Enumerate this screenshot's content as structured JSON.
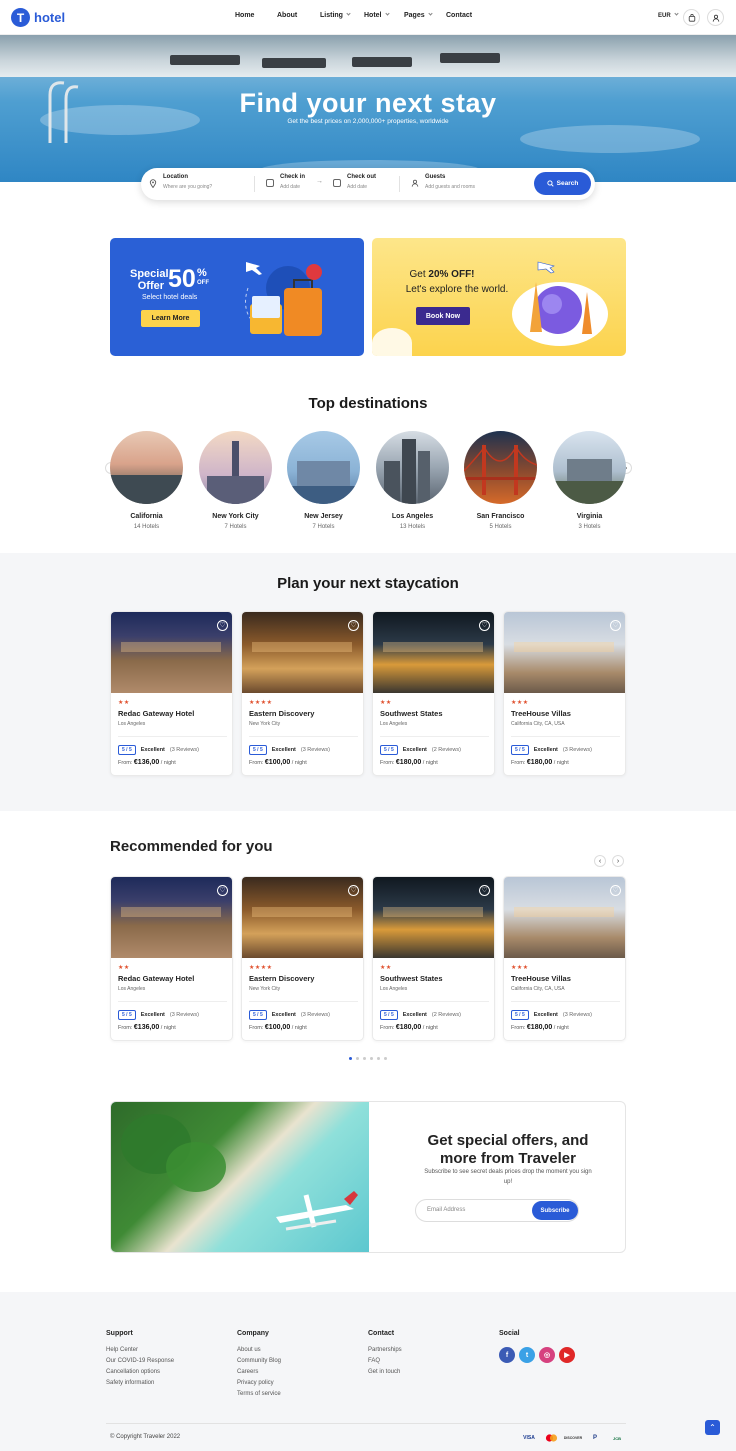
{
  "brand": {
    "logo_letter": "T",
    "name": "hotel",
    "accent": "#2a5bd7"
  },
  "nav": {
    "items": [
      {
        "label": "Home",
        "has_caret": false
      },
      {
        "label": "About",
        "has_caret": false
      },
      {
        "label": "Listing",
        "has_caret": true
      },
      {
        "label": "Hotel",
        "has_caret": true
      },
      {
        "label": "Pages",
        "has_caret": true
      },
      {
        "label": "Contact",
        "has_caret": false
      }
    ],
    "currency": "EUR"
  },
  "hero": {
    "title": "Find your next stay",
    "subtitle": "Get the best prices on 2,000,000+ properties, worldwide"
  },
  "search": {
    "location": {
      "label": "Location",
      "placeholder": "Where are you going?"
    },
    "check_in": {
      "label": "Check in",
      "placeholder": "Add date"
    },
    "check_out": {
      "label": "Check out",
      "placeholder": "Add date"
    },
    "guests": {
      "label": "Guests",
      "placeholder": "Add guests and rooms"
    },
    "button": "Search"
  },
  "promo1": {
    "line1": "Special",
    "line2": "Offer",
    "big": "50",
    "pct": "%",
    "off": "OFF",
    "sub": "Select hotel deals",
    "button": "Learn More"
  },
  "promo2": {
    "pre": "Get ",
    "bold": "20% OFF!",
    "line2": "Let's explore the world.",
    "button": "Book Now"
  },
  "destinations": {
    "title": "Top destinations",
    "items": [
      {
        "name": "California",
        "count": "14 Hotels"
      },
      {
        "name": "New York City",
        "count": "7 Hotels"
      },
      {
        "name": "New Jersey",
        "count": "7 Hotels"
      },
      {
        "name": "Los Angeles",
        "count": "13 Hotels"
      },
      {
        "name": "San Francisco",
        "count": "5 Hotels"
      },
      {
        "name": "Virginia",
        "count": "3 Hotels"
      }
    ]
  },
  "staycation": {
    "title": "Plan your next staycation"
  },
  "hotels": [
    {
      "stars": "★★",
      "name": "Redac Gateway Hotel",
      "location": "Los Angeles",
      "score": "5 / 5",
      "label": "Excellent",
      "reviews": "(3 Reviews)",
      "from": "From:",
      "price": "€136,00",
      "unit": "/ night"
    },
    {
      "stars": "★★★★",
      "name": "Eastern Discovery",
      "location": "New York City",
      "score": "5 / 5",
      "label": "Excellent",
      "reviews": "(3 Reviews)",
      "from": "From:",
      "price": "€100,00",
      "unit": "/ night"
    },
    {
      "stars": "★★",
      "name": "Southwest States",
      "location": "Los Angeles",
      "score": "5 / 5",
      "label": "Excellent",
      "reviews": "(2 Reviews)",
      "from": "From:",
      "price": "€180,00",
      "unit": "/ night"
    },
    {
      "stars": "★★★",
      "name": "TreeHouse Villas",
      "location": "California City, CA, USA",
      "score": "5 / 5",
      "label": "Excellent",
      "reviews": "(3 Reviews)",
      "from": "From:",
      "price": "€180,00",
      "unit": "/ night"
    }
  ],
  "recommended": {
    "title": "Recommended for you"
  },
  "newsletter": {
    "title": "Get special offers, and more from Traveler",
    "subtitle": "Subscribe to see secret deals prices drop the moment you sign up!",
    "placeholder": "Email Address",
    "button": "Subscribe"
  },
  "footer": {
    "cols": [
      {
        "title": "Support",
        "links": [
          "Help Center",
          "Our COVID-19 Response",
          "Cancellation options",
          "Safety information"
        ]
      },
      {
        "title": "Company",
        "links": [
          "About us",
          "Community Blog",
          "Careers",
          "Privacy policy",
          "Terms of service"
        ]
      },
      {
        "title": "Contact",
        "links": [
          "Partnerships",
          "FAQ",
          "Get in touch"
        ]
      }
    ],
    "social_title": "Social",
    "social": [
      {
        "icon": "facebook-icon",
        "glyph": "f",
        "color": "#3b5bb5"
      },
      {
        "icon": "twitter-icon",
        "glyph": "t",
        "color": "#3aa1e6"
      },
      {
        "icon": "instagram-icon",
        "glyph": "◎",
        "color": "#d6417f"
      },
      {
        "icon": "youtube-icon",
        "glyph": "▶",
        "color": "#e02828"
      }
    ],
    "copyright": "© Copyright Traveler 2022",
    "payments": [
      "VISA",
      "MC",
      "DISCOVER",
      "P",
      "JCB"
    ]
  }
}
